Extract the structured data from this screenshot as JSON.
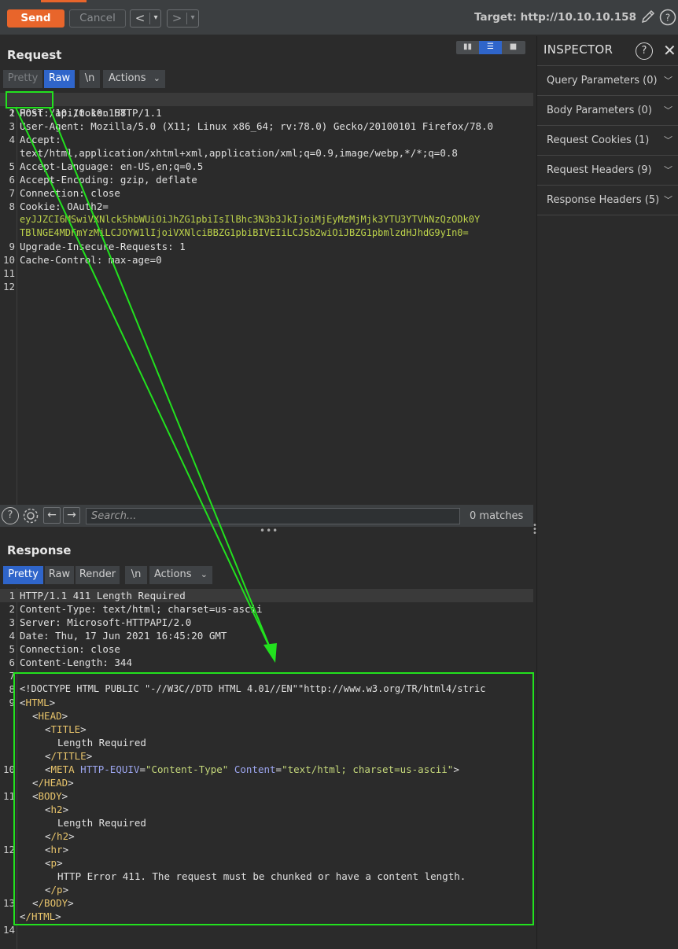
{
  "toolbar": {
    "send_label": "Send",
    "cancel_label": "Cancel",
    "back_glyph": "<",
    "forward_glyph": ">",
    "dropdown_glyph": "▾",
    "target_label": "Target: http://10.10.10.158",
    "edit_icon": "pencil-icon",
    "help_icon": "help-icon"
  },
  "request": {
    "title": "Request",
    "view_modes": [
      "split-horizontal",
      "split-vertical",
      "single"
    ],
    "tabs": [
      {
        "label": "Pretty",
        "state": "disabled"
      },
      {
        "label": "Raw",
        "state": "active"
      },
      {
        "label": "\\n",
        "state": "normal"
      },
      {
        "label": "Actions",
        "state": "normal"
      }
    ],
    "lines": [
      {
        "n": "1",
        "text": "POST /api/token HTTP/1.1"
      },
      {
        "n": "2",
        "text": "Host: 10.10.10.158"
      },
      {
        "n": "3",
        "text": "User-Agent: Mozilla/5.0 (X11; Linux x86_64; rv:78.0) Gecko/20100101 Firefox/78.0"
      },
      {
        "n": "4",
        "text": "Accept:"
      },
      {
        "n": "",
        "text": "text/html,application/xhtml+xml,application/xml;q=0.9,image/webp,*/*;q=0.8"
      },
      {
        "n": "5",
        "text": "Accept-Language: en-US,en;q=0.5"
      },
      {
        "n": "6",
        "text": "Accept-Encoding: gzip, deflate"
      },
      {
        "n": "7",
        "text": "Connection: close"
      },
      {
        "n": "8",
        "text": "Cookie: OAuth2="
      },
      {
        "n": "",
        "text": "eyJJZCI6MSwiVXNlck5hbWUiOiJhZG1pbiIsIlBhc3N3b3JkIjoiMjEyMzMjMjk3YTU3YTVhNzQzODk0YTBlNGE4MDFmYzMiLCJOYW1lIjoiVXNlciBBZG1pbiBIVEIiLCJSb2xlIjoiJBZG1pbmlzdHJhdG9yIn0="
      },
      {
        "n": "",
        "text": "TBlNGE4MDFmYzMiLCJOYW1lIjoiVXNlciBBZG1pbiBIVEIiLCJSb2wiOiJBZG1pbmlzdHJhdG9yIn0="
      },
      {
        "n": "9",
        "text": "Upgrade-Insecure-Requests: 1"
      },
      {
        "n": "10",
        "text": "Cache-Control: max-age=0"
      },
      {
        "n": "11",
        "text": ""
      },
      {
        "n": "12",
        "text": ""
      }
    ],
    "cookie_lines": [
      "eyJJZCI6MSwiVXNlck5hbWUiOiJhZG1pbiIsIlBhc3N3b3JkIjoiMjEyMzMjMjk3YTU3YTVhNzQzODk0Y",
      "TBlNGE4MDFmYzMiLCJOYW1lIjoiVXNlciBBZG1pbiBIVEIiLCJSb2wiOiJBZG1pbmlzdHJhdG9yIn0="
    ]
  },
  "search": {
    "placeholder": "Search...",
    "matches": "0 matches"
  },
  "response": {
    "title": "Response",
    "tabs": [
      {
        "label": "Pretty",
        "state": "active"
      },
      {
        "label": "Raw",
        "state": "normal"
      },
      {
        "label": "Render",
        "state": "normal"
      },
      {
        "label": "\\n",
        "state": "normal"
      },
      {
        "label": "Actions",
        "state": "normal"
      }
    ],
    "headers": [
      {
        "n": "1",
        "text": "HTTP/1.1 411 Length Required"
      },
      {
        "n": "2",
        "text": "Content-Type: text/html; charset=us-ascii"
      },
      {
        "n": "3",
        "text": "Server: Microsoft-HTTPAPI/2.0"
      },
      {
        "n": "4",
        "text": "Date: Thu, 17 Jun 2021 16:45:20 GMT"
      },
      {
        "n": "5",
        "text": "Connection: close"
      },
      {
        "n": "6",
        "text": "Content-Length: 344"
      },
      {
        "n": "7",
        "text": ""
      }
    ],
    "body": {
      "doctype": "<!DOCTYPE HTML PUBLIC \"-//W3C//DTD HTML 4.01//EN\"\"http://www.w3.org/TR/html4/stric",
      "html_open": "HTML",
      "head_open": "HEAD",
      "title_open": "TITLE",
      "title_text": "Length Required",
      "title_close": "/TITLE",
      "meta_tag": "META",
      "meta_attr1": "HTTP-EQUIV",
      "meta_val1": "\"Content-Type\"",
      "meta_attr2": "Content",
      "meta_val2": "\"text/html; charset=us-ascii\"",
      "head_close": "/HEAD",
      "body_open": "BODY",
      "h2_open": "h2",
      "h2_text": "Length Required",
      "h2_close": "/h2",
      "hr_tag": "hr",
      "p_open": "p",
      "p_text": "HTTP Error 411. The request must be chunked or have a content length.",
      "p_close": "/p",
      "body_close": "/BODY",
      "html_close": "/HTML"
    },
    "body_line_numbers": [
      "8",
      "9",
      "10",
      "11",
      "12",
      "13",
      "14"
    ]
  },
  "inspector": {
    "title": "INSPECTOR",
    "items": [
      {
        "label": "Query Parameters (0)"
      },
      {
        "label": "Body Parameters (0)"
      },
      {
        "label": "Request Cookies (1)"
      },
      {
        "label": "Request Headers (9)"
      },
      {
        "label": "Response Headers (5)"
      }
    ]
  },
  "colors": {
    "accent": "#e8652b",
    "active_tab": "#2f65ca",
    "annotation": "#22e11e",
    "tag": "#e8c46b",
    "attr": "#9da6f0",
    "value": "#c4d77a"
  }
}
